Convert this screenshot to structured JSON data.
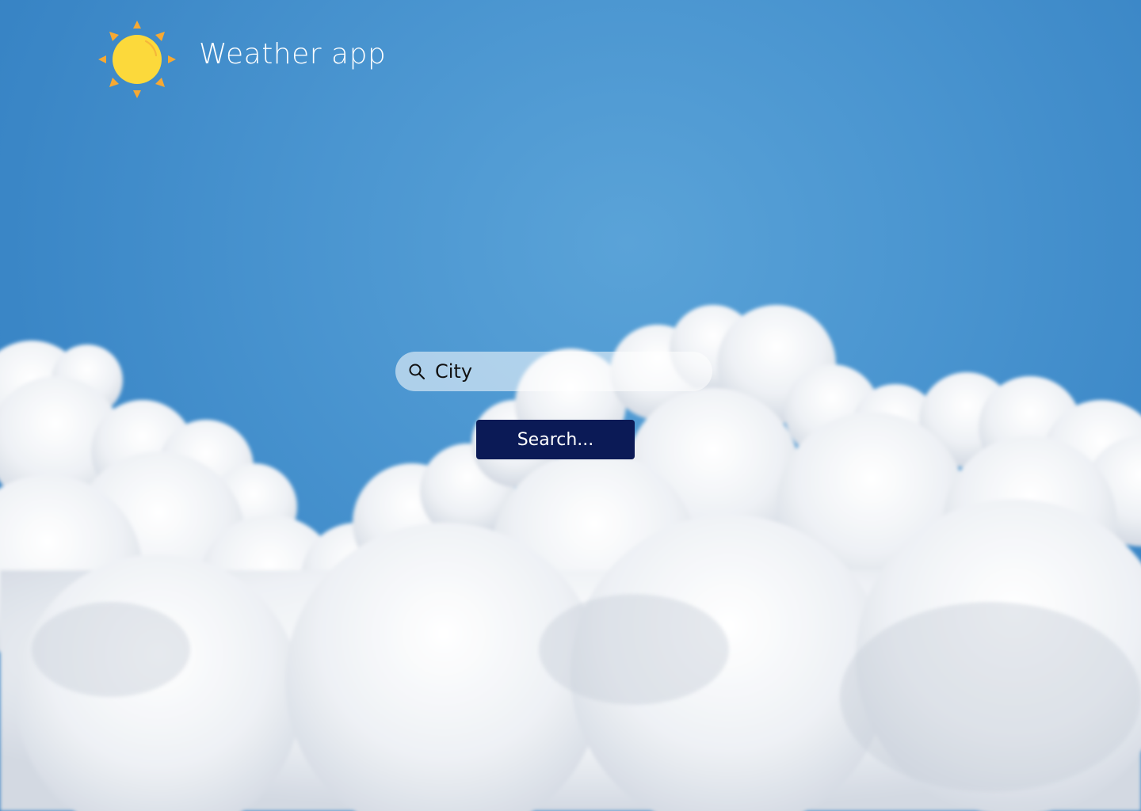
{
  "app": {
    "title": "Weather app",
    "logo_icon": "sun-icon"
  },
  "search": {
    "placeholder": "City",
    "value": "",
    "icon": "search-icon",
    "button_label": "Search..."
  },
  "colors": {
    "sky_blue": "#4a95d0",
    "button_navy": "#0b1a56",
    "sun_yellow": "#fcd93b",
    "sun_rays": "#f7a933",
    "text_white": "#ffffff"
  }
}
